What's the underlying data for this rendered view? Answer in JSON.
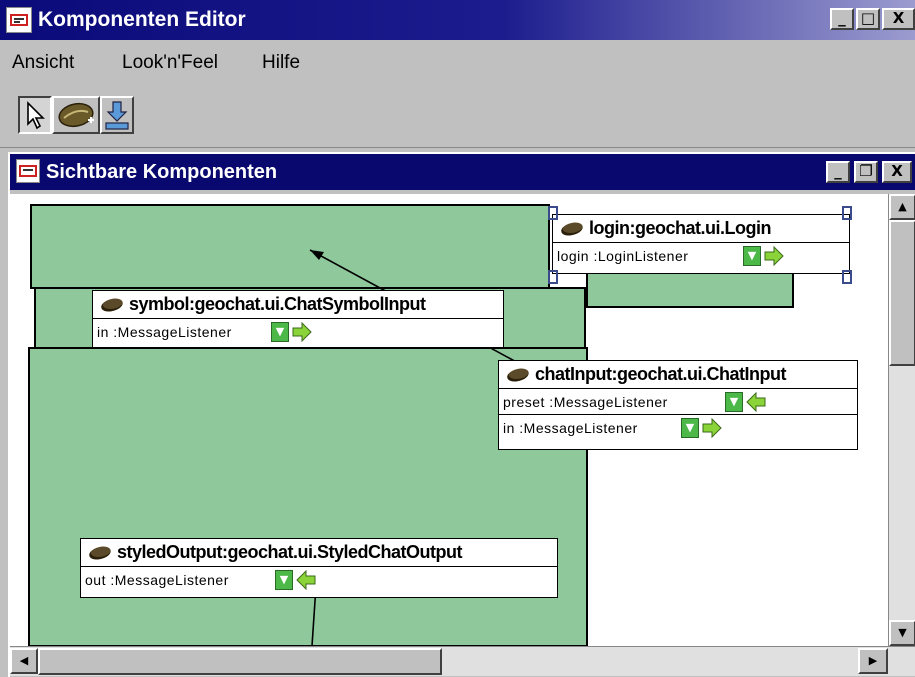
{
  "window": {
    "title": "Komponenten Editor",
    "minimize": "_",
    "maximize": "□",
    "close": "X"
  },
  "menu": [
    "Ansicht",
    "Look'n'Feel",
    "Hilfe"
  ],
  "toolbar": {
    "tools": [
      {
        "name": "select-tool",
        "icon": "arrow-pointer-icon",
        "pressed": true
      },
      {
        "name": "bean-tool",
        "icon": "bean-icon",
        "pressed": false
      },
      {
        "name": "import-tool",
        "icon": "download-icon",
        "pressed": false
      }
    ]
  },
  "inner_window": {
    "title": "Sichtbare Komponenten",
    "minimize": "_",
    "restore": "❐",
    "close": "X"
  },
  "components": {
    "login": {
      "name": "login:geochat.ui.Login",
      "ports": [
        "login :LoginListener"
      ]
    },
    "symbol": {
      "name": "symbol:geochat.ui.ChatSymbolInput",
      "ports": [
        "in :MessageListener"
      ]
    },
    "chatinput": {
      "name": "chatInput:geochat.ui.ChatInput",
      "ports": [
        "preset :MessageListener",
        "in :MessageListener"
      ]
    },
    "styled": {
      "name": "styledOutput:geochat.ui.StyledChatOutput",
      "ports": [
        "out :MessageListener"
      ]
    }
  },
  "colors": {
    "title_bar": "#0a0a7a",
    "component_area": "#8fc89b",
    "port_icon": "#4cb848",
    "arrow_in": "#8ad43a"
  },
  "scrollbars": {
    "up": "▲",
    "down": "▼",
    "left": "◀",
    "right": "▶"
  }
}
